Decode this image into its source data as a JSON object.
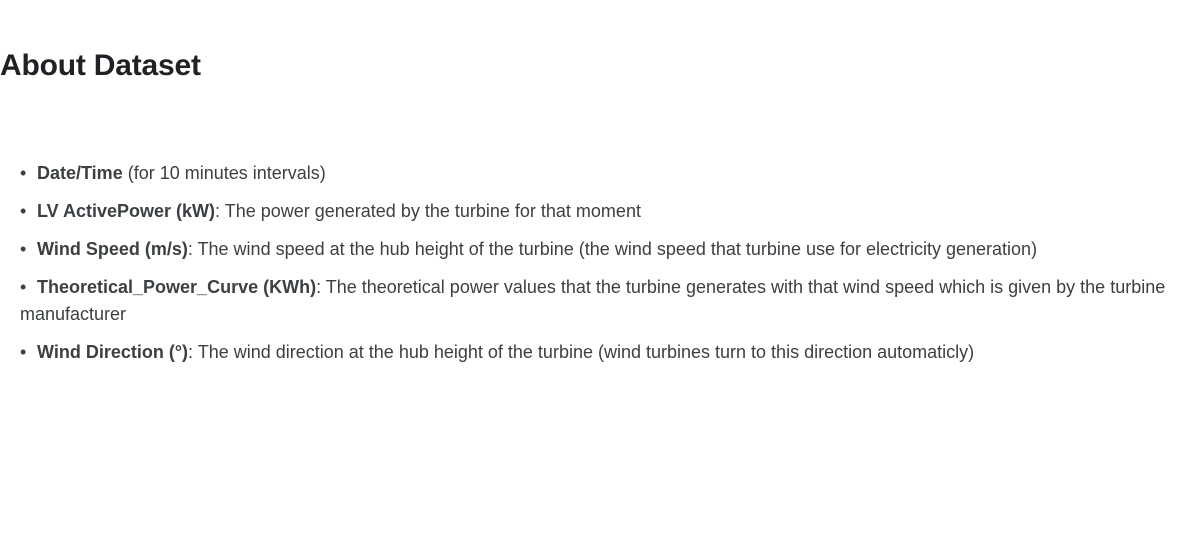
{
  "heading": "About Dataset",
  "items": [
    {
      "bullet": "•",
      "term": "Date/Time",
      "desc": " (for 10 minutes intervals)"
    },
    {
      "bullet": "•",
      "term": "LV ActivePower (kW)",
      "desc": ": The power generated by the turbine for that moment"
    },
    {
      "bullet": "•",
      "term": "Wind Speed (m/s)",
      "desc": ": The wind speed at the hub height of the turbine (the wind speed that turbine use for electricity generation)"
    },
    {
      "bullet": "•",
      "term": "Theoretical_Power_Curve (KWh)",
      "desc": ": The theoretical power values that the turbine generates with that wind speed which is given by the turbine manufacturer"
    },
    {
      "bullet": "•",
      "term": "Wind Direction (°)",
      "desc": ": The wind direction at the hub height of the turbine (wind turbines turn to this direction automaticly)"
    }
  ]
}
